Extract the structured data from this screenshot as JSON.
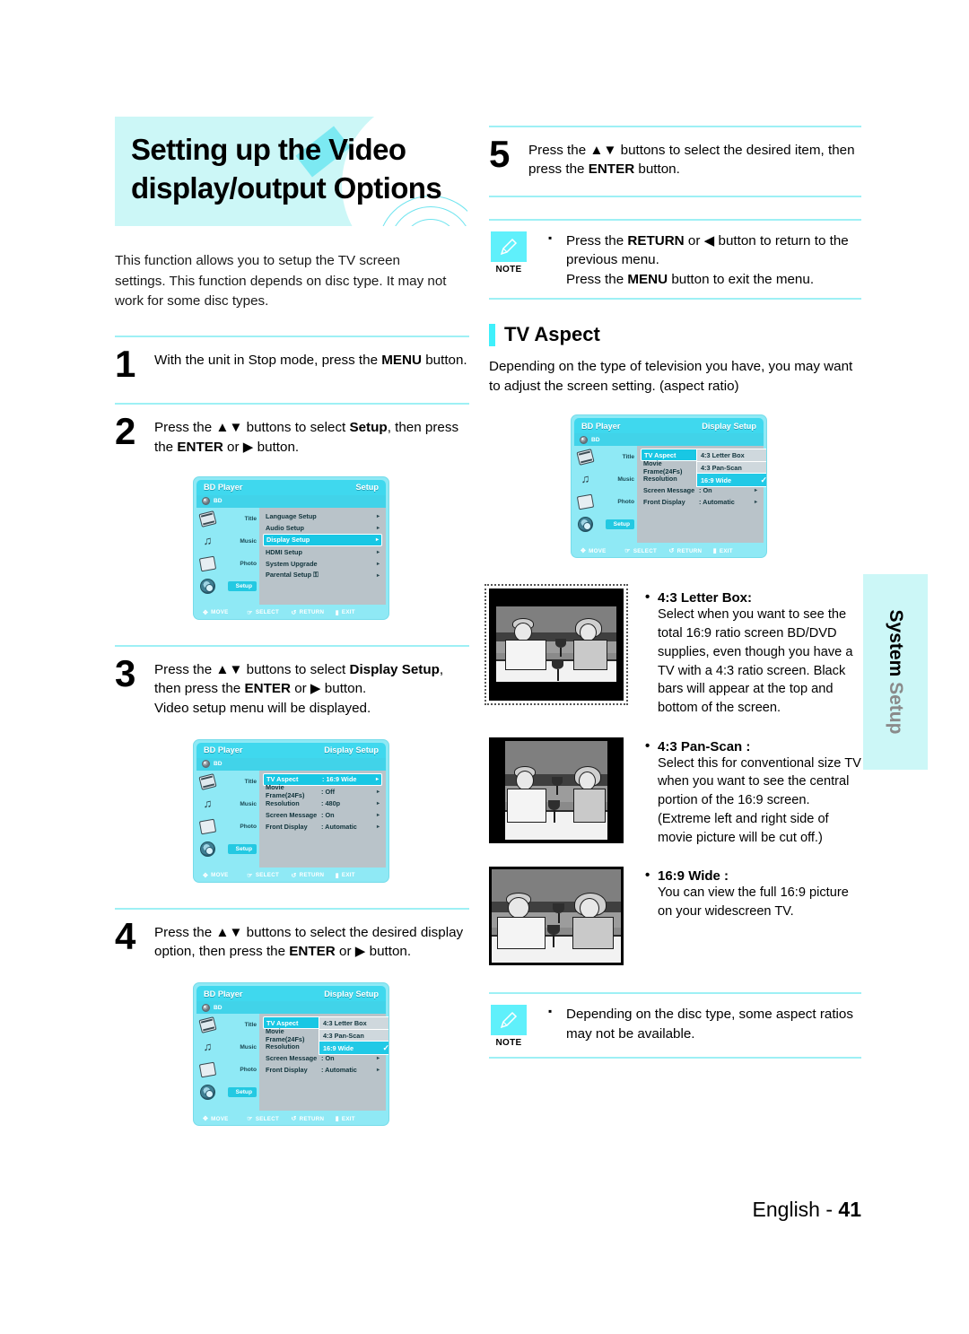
{
  "header": {
    "title_line1": "Setting up the Video",
    "title_line2": "display/output Options",
    "intro": "This function allows you to setup the TV screen settings. This function depends on disc type. It may not work for some disc types."
  },
  "steps": [
    {
      "num": "1",
      "html": "With the unit in Stop mode, press the <b>MENU</b> button."
    },
    {
      "num": "2",
      "html": "Press the ▲▼ buttons to select <b>Setup</b>, then press the <b>ENTER</b> or ▶ button."
    },
    {
      "num": "3",
      "html": "Press the ▲▼ buttons to select <b>Display Setup</b>, then press the <b>ENTER</b> or ▶ button.<br>Video setup menu will be displayed."
    },
    {
      "num": "4",
      "html": "Press the ▲▼ buttons to select the desired display option, then press the <b>ENTER</b> or ▶ button."
    },
    {
      "num": "5",
      "html": "Press the ▲▼ buttons to select the desired item, then press the <b>ENTER</b> button."
    }
  ],
  "osd_common": {
    "brand": "BD Player",
    "disc_label": "BD",
    "side_items": [
      "Title",
      "Music",
      "Photo",
      "Setup"
    ],
    "footer": [
      {
        "glyph": "✥",
        "label": "MOVE"
      },
      {
        "glyph": "☞",
        "label": "SELECT"
      },
      {
        "glyph": "↺",
        "label": "RETURN"
      },
      {
        "glyph": "▮",
        "label": "EXIT"
      }
    ]
  },
  "osd_setup": {
    "title_right": "Setup",
    "rows": [
      {
        "name": "Language Setup",
        "value": "",
        "arrow": "▸",
        "highlight": false
      },
      {
        "name": "Audio Setup",
        "value": "",
        "arrow": "▸",
        "highlight": false
      },
      {
        "name": "Display Setup",
        "value": "",
        "arrow": "▸",
        "highlight": true
      },
      {
        "name": "HDMI Setup",
        "value": "",
        "arrow": "▸",
        "highlight": false
      },
      {
        "name": "System Upgrade",
        "value": "",
        "arrow": "▸",
        "highlight": false
      },
      {
        "name": "Parental Setup ⚿",
        "value": "",
        "arrow": "▸",
        "highlight": false
      }
    ]
  },
  "osd_display": {
    "title_right": "Display Setup",
    "rows": [
      {
        "name": "TV Aspect",
        "value": ": 16:9 Wide",
        "arrow": "▸",
        "highlight": true
      },
      {
        "name": "Movie Frame(24Fs)",
        "value": ": Off",
        "arrow": "▸",
        "highlight": false
      },
      {
        "name": "Resolution",
        "value": ": 480p",
        "arrow": "▸",
        "highlight": false
      },
      {
        "name": "Screen Message",
        "value": ": On",
        "arrow": "▸",
        "highlight": false
      },
      {
        "name": "Front Display",
        "value": ": Automatic",
        "arrow": "▸",
        "highlight": false
      }
    ]
  },
  "osd_dropdown": {
    "title_right": "Display Setup",
    "rows": [
      {
        "name": "TV Aspect",
        "value": "",
        "arrow": "",
        "highlight": true
      },
      {
        "name": "Movie Frame(24Fs)",
        "value": "",
        "arrow": "",
        "highlight": false
      },
      {
        "name": "Resolution",
        "value": "",
        "arrow": "",
        "highlight": false
      },
      {
        "name": "Screen Message",
        "value": ": On",
        "arrow": "▸",
        "highlight": false
      },
      {
        "name": "Front Display",
        "value": ": Automatic",
        "arrow": "▸",
        "highlight": false
      }
    ],
    "options": [
      {
        "label": "4:3  Letter Box",
        "selected": false,
        "check": ""
      },
      {
        "label": "4:3  Pan-Scan",
        "selected": false,
        "check": ""
      },
      {
        "label": "16:9 Wide",
        "selected": true,
        "check": "✓"
      }
    ]
  },
  "note_top": {
    "label": "NOTE",
    "line1_html": "Press the <b>RETURN</b> or ◀ button to return to the previous menu.",
    "line2_html": "Press the <b>MENU</b> button to exit the menu."
  },
  "note_bottom": {
    "label": "NOTE",
    "line1_html": "Depending on the disc type, some aspect ratios may not be available."
  },
  "tv_aspect": {
    "heading": "TV Aspect",
    "desc": "Depending on the type of television you have, you may want to adjust the screen setting. (aspect ratio)",
    "items": [
      {
        "title": "4:3 Letter Box:",
        "desc": "Select when you want to see the total 16:9 ratio screen BD/DVD supplies, even though you have a TV with a 4:3 ratio screen. Black bars will appear at the top and bottom of the screen.",
        "mode": "letterbox"
      },
      {
        "title": "4:3 Pan-Scan :",
        "desc": "Select this for conventional size TV when you want to see the central portion of the 16:9 screen. (Extreme left and right side of movie picture will be cut off.)",
        "mode": "panscan"
      },
      {
        "title": "16:9 Wide :",
        "desc": "You can view the full 16:9 picture on your widescreen TV.",
        "mode": "wide"
      }
    ]
  },
  "side_tab": {
    "word1": "System",
    "word2": "Setup"
  },
  "footer": {
    "language": "English - ",
    "page": "41"
  },
  "colors": {
    "banner_bg": "#CCF7F7",
    "rule": "#9EF0F5",
    "accent_cyan": "#3FF0FB",
    "osd_header": "#3FD8EE",
    "osd_body": "#8FE9F5",
    "osd_list": "#B9C3C9",
    "osd_highlight": "#18C7E4"
  }
}
